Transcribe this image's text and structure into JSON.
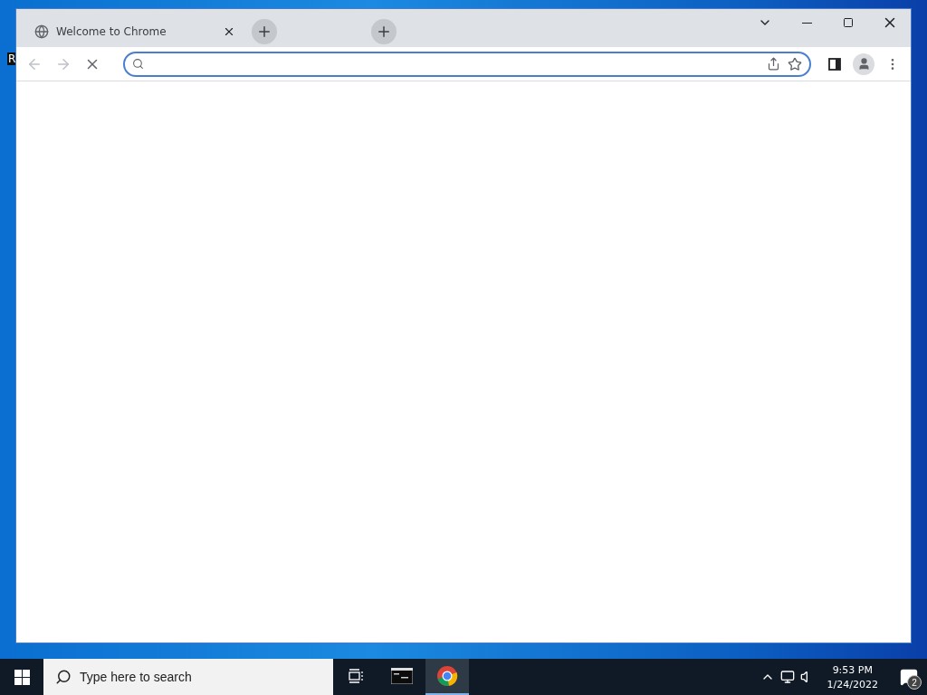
{
  "desktop": {
    "fragment_text": "R"
  },
  "browser": {
    "tabs": [
      {
        "title": "Welcome to Chrome"
      }
    ],
    "loading": true
  },
  "taskbar": {
    "search": {
      "placeholder": "Type here to search"
    },
    "apps": [
      {
        "kind": "terminal",
        "active": false
      },
      {
        "kind": "chrome",
        "active": true
      }
    ],
    "clock": {
      "time": "9:53 PM",
      "date": "1/24/2022"
    },
    "notifications": {
      "count": "2"
    }
  }
}
